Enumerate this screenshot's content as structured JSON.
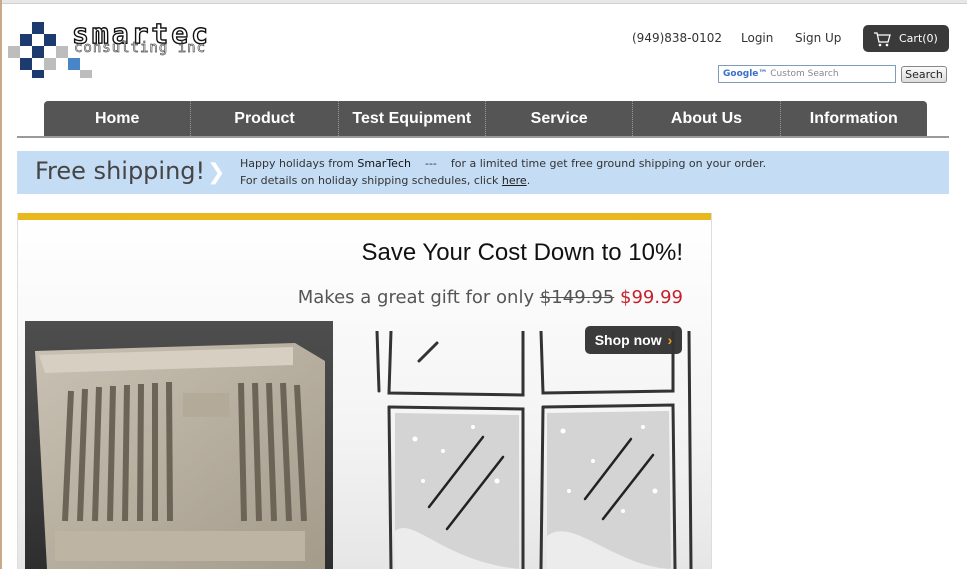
{
  "header": {
    "logo_alt": "smartec consulting inc",
    "logo_word": "smartec",
    "logo_sub": "consulting inc",
    "phone": "(949)838-0102",
    "login": "Login",
    "signup": "Sign Up",
    "cart": "Cart(0)",
    "search_placeholder_brand": "Google™",
    "search_placeholder": "Custom Search",
    "search_button": "Search"
  },
  "nav": {
    "items": [
      "Home",
      "Product",
      "Test Equipment",
      "Service",
      "About Us",
      "Information"
    ]
  },
  "shipping": {
    "title": "Free shipping!",
    "line1_pre": "Happy holidays from",
    "line1_brand": "SmarTech",
    "line1_sep": "---",
    "line1_post": "for a limited time get free ground shipping on your order.",
    "line2_pre": "For details on holiday shipping schedules, click",
    "line2_link": "here",
    "line2_post": "."
  },
  "banner": {
    "headline": "Save Your Cost Down to 10%!",
    "gift_text": "Makes a great gift for only",
    "old_price": "$149.95",
    "new_price": "$99.99",
    "shop_button": "Shop now",
    "shop_arrow": "›"
  },
  "colors": {
    "nav_bg": "#555555",
    "shipping_bg": "#c5dcf5",
    "banner_accent": "#e9b81d",
    "price_red": "#c8202b",
    "logo_navy": "#1d3b6e",
    "logo_blue": "#4a86c5"
  }
}
